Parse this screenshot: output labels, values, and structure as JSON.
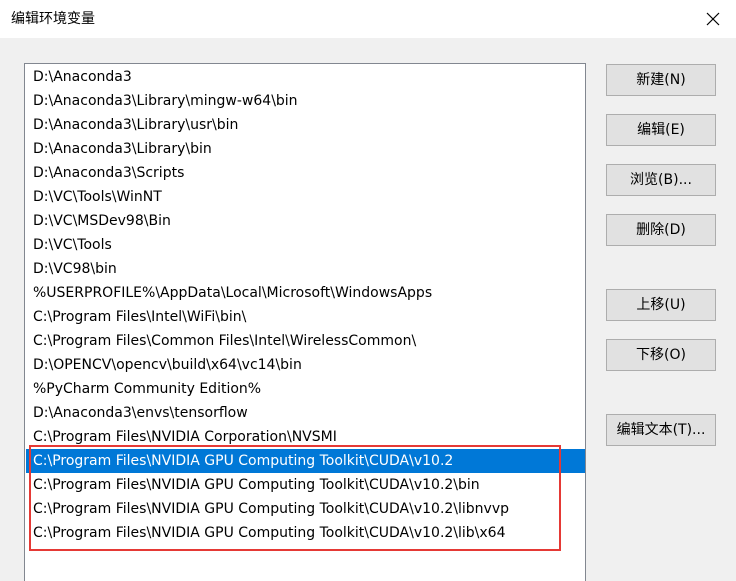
{
  "window": {
    "title": "编辑环境变量",
    "close_icon": "close-icon"
  },
  "path_list": {
    "selected_index": 15,
    "items": [
      "D:\\Anaconda3",
      "D:\\Anaconda3\\Library\\mingw-w64\\bin",
      "D:\\Anaconda3\\Library\\usr\\bin",
      "D:\\Anaconda3\\Library\\bin",
      "D:\\Anaconda3\\Scripts",
      "D:\\VC\\Tools\\WinNT",
      "D:\\VC\\MSDev98\\Bin",
      "D:\\VC\\Tools",
      "D:\\VC98\\bin",
      "%USERPROFILE%\\AppData\\Local\\Microsoft\\WindowsApps",
      "C:\\Program Files\\Intel\\WiFi\\bin\\",
      "C:\\Program Files\\Common Files\\Intel\\WirelessCommon\\",
      "D:\\OPENCV\\opencv\\build\\x64\\vc14\\bin",
      "%PyCharm Community Edition%",
      "D:\\Anaconda3\\envs\\tensorflow",
      "C:\\Program Files\\NVIDIA Corporation\\NVSMI",
      "C:\\Program Files\\NVIDIA GPU Computing Toolkit\\CUDA\\v10.2",
      "C:\\Program Files\\NVIDIA GPU Computing Toolkit\\CUDA\\v10.2\\bin",
      "C:\\Program Files\\NVIDIA GPU Computing Toolkit\\CUDA\\v10.2\\libnvvp",
      "C:\\Program Files\\NVIDIA GPU Computing Toolkit\\CUDA\\v10.2\\lib\\x64"
    ]
  },
  "buttons": {
    "new": "新建(N)",
    "edit": "编辑(E)",
    "browse": "浏览(B)...",
    "delete": "删除(D)",
    "move_up": "上移(U)",
    "move_down": "下移(O)",
    "edit_text": "编辑文本(T)..."
  },
  "colors": {
    "selection": "#0078d7",
    "highlight_box": "#e53935"
  }
}
